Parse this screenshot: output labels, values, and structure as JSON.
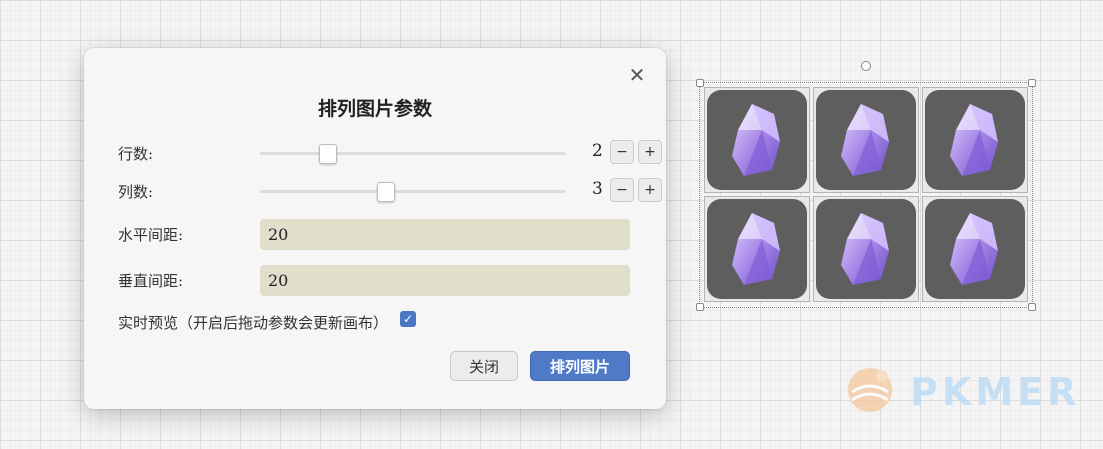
{
  "dialog": {
    "title": "排列图片参数",
    "close_icon": "close-icon",
    "rows": {
      "label": "行数:",
      "value": "2",
      "level": 0.22,
      "minus": "−",
      "plus": "+"
    },
    "cols": {
      "label": "列数:",
      "value": "3",
      "level": 0.41,
      "minus": "−",
      "plus": "+"
    },
    "h_spacing": {
      "label": "水平间距:",
      "value": "20"
    },
    "v_spacing": {
      "label": "垂直间距:",
      "value": "20"
    },
    "live_preview": {
      "label": "实时预览（开启后拖动参数会更新画布）",
      "checked": true,
      "check_glyph": "✓"
    },
    "buttons": {
      "close": "关闭",
      "arrange": "排列图片"
    }
  },
  "canvas": {
    "tile_icon": "obsidian-crystal-icon",
    "tile_bg": "#5e5e5e",
    "grid_rows": 2,
    "grid_cols": 3
  },
  "watermark": {
    "text": "PKMER"
  },
  "colors": {
    "accent": "#4f7ac7",
    "input_bg": "#e2decc",
    "crystal": "#9b7fe0"
  }
}
